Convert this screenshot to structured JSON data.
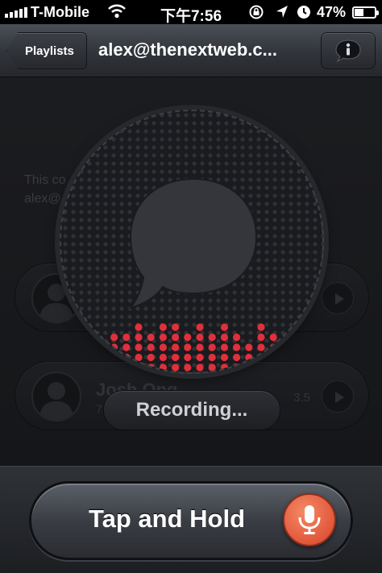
{
  "status_bar": {
    "carrier": "T-Mobile",
    "time": "下午7:56",
    "battery_percent": "47%",
    "battery_level": 0.47,
    "signal_bars": 5,
    "icons": [
      "signal-icon",
      "wifi-icon",
      "rotation-lock-icon",
      "location-icon",
      "alarm-icon",
      "battery-icon"
    ]
  },
  "nav": {
    "back_label": "Playlists",
    "title": "alex@thenextweb.c...",
    "info_icon": "info-icon"
  },
  "content": {
    "description_line1": "This co",
    "description_line2": "alex@",
    "rows": [
      {
        "name": "",
        "sub": "",
        "duration": ""
      },
      {
        "name": "Josh Ong",
        "sub": "7",
        "duration": "3.5"
      }
    ]
  },
  "recorder": {
    "icon": "speech-bubble-icon",
    "status": "Recording...",
    "level_color": "#e0303c"
  },
  "bottom": {
    "hold_label": "Tap and Hold",
    "mic_icon": "microphone-icon",
    "mic_color": "#e2573a"
  }
}
